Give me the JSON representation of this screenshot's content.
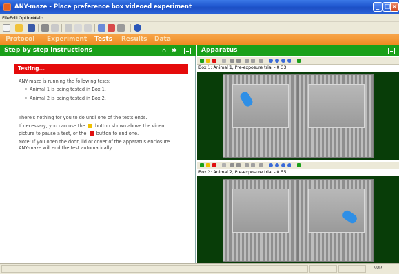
{
  "window": {
    "title": "ANY-maze - Place preference box videoed experiment"
  },
  "menu": {
    "items": [
      "File",
      "Edit",
      "Options",
      "Help"
    ]
  },
  "tabs": [
    {
      "label": "Protocol",
      "active": false
    },
    {
      "label": "Experiment",
      "active": false
    },
    {
      "label": "Tests",
      "active": true
    },
    {
      "label": "Results",
      "active": false
    },
    {
      "label": "Data",
      "active": false
    }
  ],
  "instructions": {
    "header": "Step by step instructions",
    "status": "Testing...",
    "line1": "ANY-maze is running the following tests:",
    "bullet1": "Animal 1 is being tested in Box 1.",
    "bullet2": "Animal 2 is being tested in Box 2.",
    "line2": "There's nothing for you to do until one of the tests ends.",
    "line3a": "If necessary, you can use the",
    "line3b": "button shown above the video",
    "line4a": "picture to pause a test, or the",
    "line4b": "button to end one.",
    "line5": "Note: If you open the door, lid or cover of the apparatus enclosure",
    "line6": "ANY-maze will end the test automatically."
  },
  "apparatus": {
    "header": "Apparatus",
    "box1_label": "Box 1: Animal 1, Pre-exposure trial - 0:33",
    "box2_label": "Box 2: Animal 2, Pre-exposure trial - 0:55"
  },
  "statusbar": {
    "num": "NUM"
  },
  "colors": {
    "panel_header": "#1aa01a",
    "tab_bar": "#ee8a1e",
    "testing_bar": "#e50b0b",
    "video_bg": "#083d08"
  }
}
